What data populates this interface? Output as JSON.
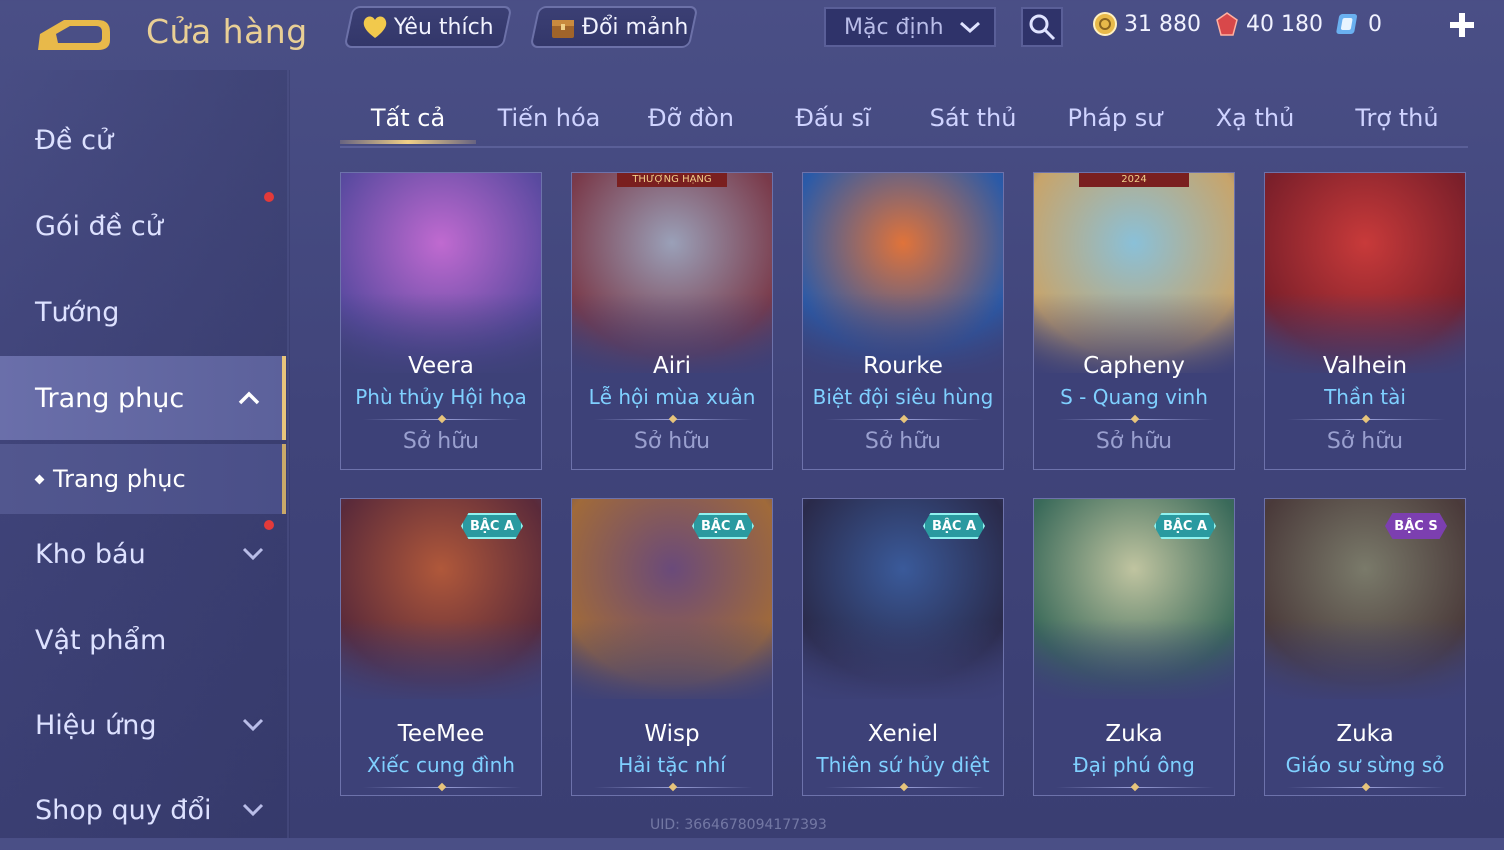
{
  "header": {
    "title": "Cửa hàng",
    "favorite_label": "Yêu thích",
    "exchange_label": "Đổi mảnh",
    "sort_label": "Mặc định",
    "currency": [
      {
        "icon": "gold-coin-icon",
        "value": "31 880"
      },
      {
        "icon": "red-gem-icon",
        "value": "40 180"
      },
      {
        "icon": "voucher-icon",
        "value": "0"
      }
    ]
  },
  "sidebar": {
    "items": [
      {
        "label": "Đề cử"
      },
      {
        "label": "Gói đề cử"
      },
      {
        "label": "Tướng"
      },
      {
        "label": "Trang phục"
      },
      {
        "label": "Kho báu"
      },
      {
        "label": "Vật phẩm"
      },
      {
        "label": "Hiệu ứng"
      },
      {
        "label": "Shop quy đổi"
      }
    ],
    "sub_item": "Trang phục"
  },
  "tabs": [
    "Tất cả",
    "Tiến hóa",
    "Đỡ đòn",
    "Đấu sĩ",
    "Sát thủ",
    "Pháp sư",
    "Xạ thủ",
    "Trợ thủ"
  ],
  "cards": [
    {
      "hero": "Veera",
      "skin": "Phù thủy Hội họa",
      "status": "Sở hữu",
      "colors": [
        "#c06ad0",
        "#5a4aa0"
      ]
    },
    {
      "hero": "Airi",
      "skin": "Lễ hội mùa xuân",
      "status": "Sở hữu",
      "colors": [
        "#9aa0b8",
        "#7a3a4a"
      ],
      "ribbon": "THƯỢNG HẠNG"
    },
    {
      "hero": "Rourke",
      "skin": "Biệt đội siêu hùng",
      "status": "Sở hữu",
      "colors": [
        "#e0733a",
        "#2a5aa8"
      ]
    },
    {
      "hero": "Capheny",
      "skin": "S - Quang vinh",
      "status": "Sở hữu",
      "colors": [
        "#8ac0d8",
        "#c8a46a"
      ],
      "ribbon": "2024"
    },
    {
      "hero": "Valhein",
      "skin": "Thần tài",
      "status": "Sở hữu",
      "colors": [
        "#c83a3a",
        "#7a1f2a"
      ]
    },
    {
      "hero": "TeeMee",
      "skin": "Xiếc cung đình",
      "status": "Sở hữu",
      "colors": [
        "#b0583a",
        "#5a2a3a"
      ],
      "tier": "BẬC A"
    },
    {
      "hero": "Wisp",
      "skin": "Hải tặc nhí",
      "status": "Sở hữu",
      "colors": [
        "#6a4a7a",
        "#a06a3a"
      ],
      "tier": "BẬC A"
    },
    {
      "hero": "Xeniel",
      "skin": "Thiên sứ hủy diệt",
      "status": "Sở hữu",
      "colors": [
        "#3a5a9a",
        "#2a2a4a"
      ],
      "tier": "BẬC A"
    },
    {
      "hero": "Zuka",
      "skin": "Đại phú ông",
      "status": "Sở hữu",
      "colors": [
        "#c0c4a0",
        "#3a6a5a"
      ],
      "tier": "BẬC A"
    },
    {
      "hero": "Zuka",
      "skin": "Giáo sư sừng sỏ",
      "status": "Sở hữu",
      "colors": [
        "#7a7a6a",
        "#4a3a3a"
      ],
      "tier": "BẬC S"
    }
  ],
  "uid_text": "UID: 3664678094177393"
}
